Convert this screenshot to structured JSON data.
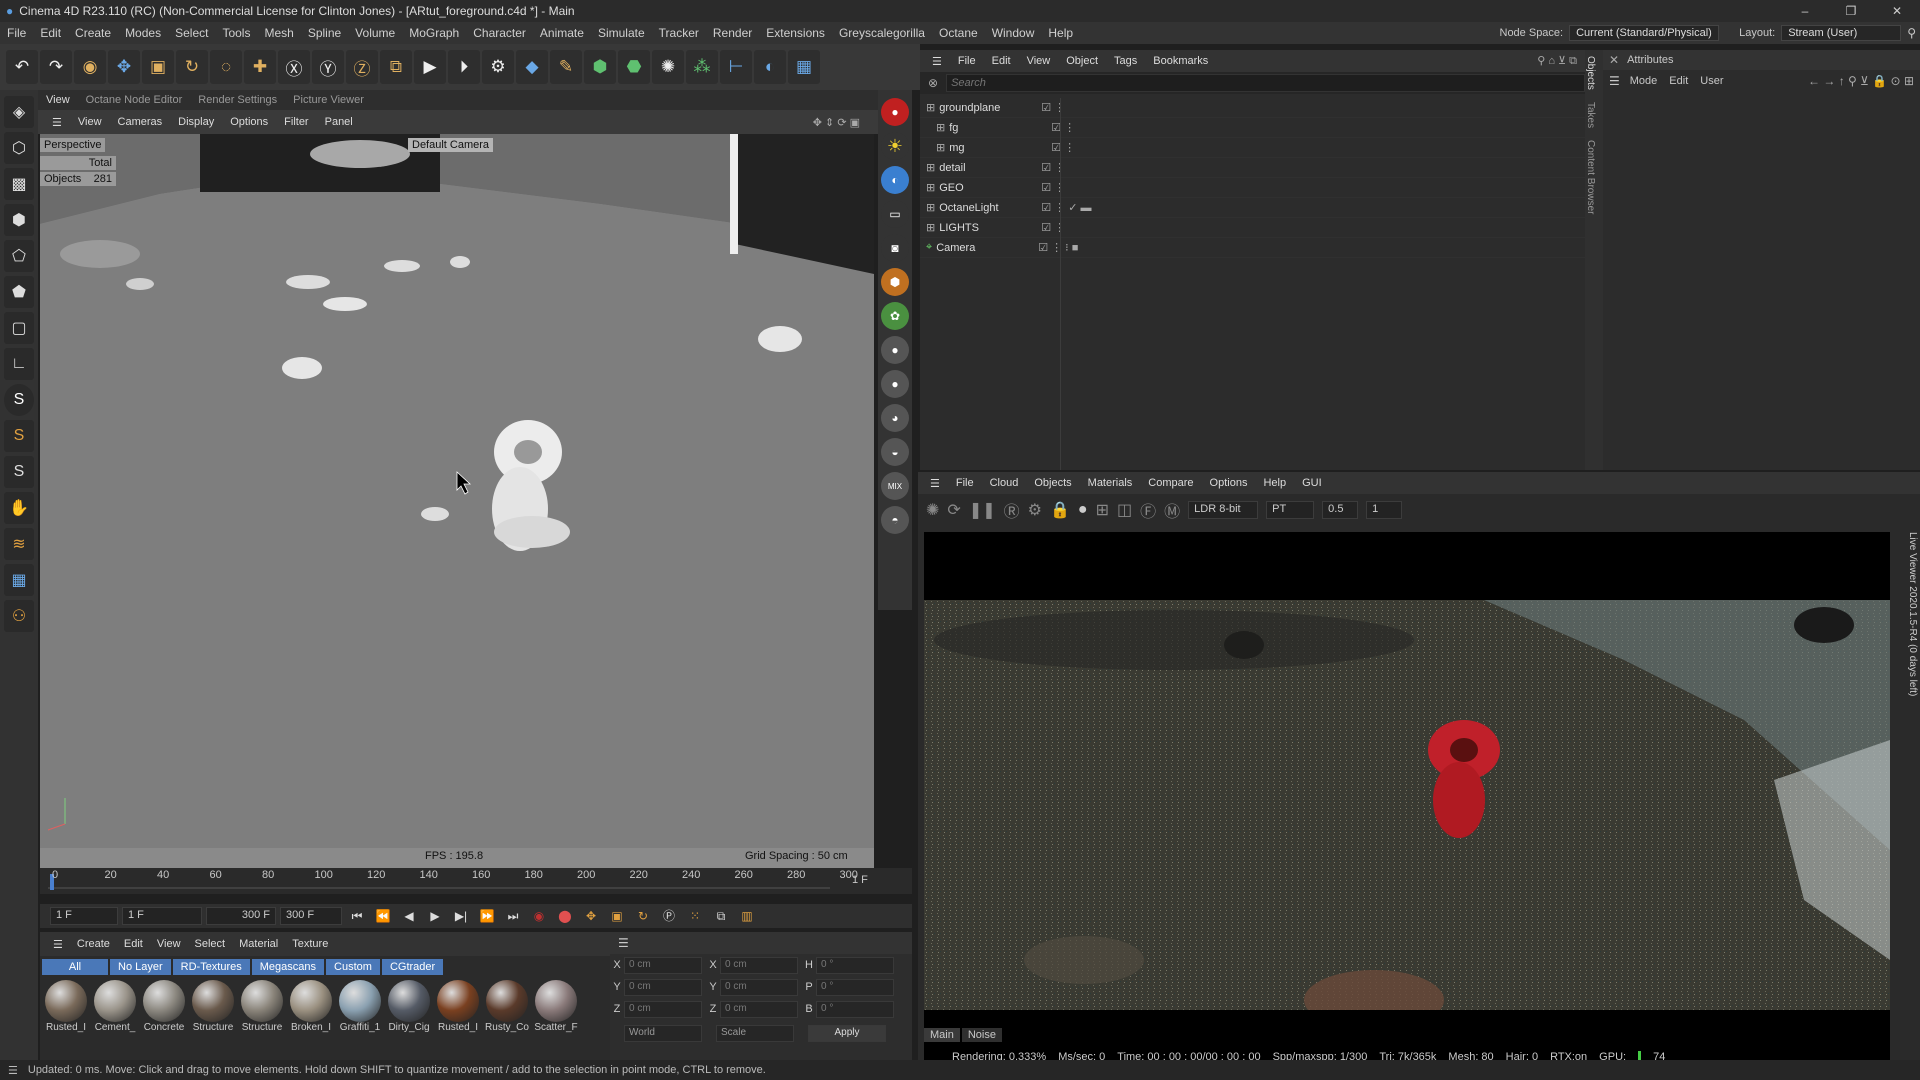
{
  "window": {
    "title": "Cinema 4D R23.110 (RC) (Non-Commercial License for Clinton Jones) - [ARtut_foreground.c4d *] - Main"
  },
  "menubar": {
    "items": [
      "File",
      "Edit",
      "Create",
      "Modes",
      "Select",
      "Tools",
      "Mesh",
      "Spline",
      "Volume",
      "MoGraph",
      "Character",
      "Animate",
      "Simulate",
      "Tracker",
      "Render",
      "Extensions",
      "Greyscalegorilla",
      "Octane",
      "Window",
      "Help"
    ],
    "node_space_label": "Node Space:",
    "node_space_value": "Current (Standard/Physical)",
    "layout_label": "Layout:",
    "layout_value": "Stream (User)"
  },
  "viewport": {
    "tabs": [
      "View",
      "Octane Node Editor",
      "Render Settings",
      "Picture Viewer"
    ],
    "menu": [
      "View",
      "Cameras",
      "Display",
      "Options",
      "Filter",
      "Panel"
    ],
    "projection": "Perspective",
    "camera": "Default Camera",
    "total_label": "Total",
    "objects_label": "Objects",
    "objects_count": "281",
    "fps": "FPS : 195.8",
    "grid_spacing": "Grid Spacing : 50 cm"
  },
  "timeline": {
    "ticks": [
      "0",
      "20",
      "40",
      "60",
      "80",
      "100",
      "120",
      "140",
      "160",
      "180",
      "200",
      "220",
      "240",
      "260",
      "280",
      "300"
    ],
    "current_frame": "1 F"
  },
  "transport": {
    "start": "1 F",
    "current": "1 F",
    "end": "300 F",
    "end2": "300 F"
  },
  "materials": {
    "menu": [
      "Create",
      "Edit",
      "View",
      "Select",
      "Material",
      "Texture"
    ],
    "filters": [
      "All",
      "No Layer",
      "RD-Textures",
      "Megascans",
      "Custom",
      "CGtrader"
    ],
    "items": [
      {
        "name": "Rusted_I",
        "color": "#7a6a5a"
      },
      {
        "name": "Cement_",
        "color": "#9a948a"
      },
      {
        "name": "Concrete",
        "color": "#8c8880"
      },
      {
        "name": "Structure",
        "color": "#6a5a4c"
      },
      {
        "name": "Structure",
        "color": "#8a847a"
      },
      {
        "name": "Broken_I",
        "color": "#9a9080"
      },
      {
        "name": "Graffiti_1",
        "color": "#8aa0b0"
      },
      {
        "name": "Dirty_Cig",
        "color": "#555b66"
      },
      {
        "name": "Rusted_I",
        "color": "#7a4020"
      },
      {
        "name": "Rusty_Co",
        "color": "#5a3a2a"
      },
      {
        "name": "Scatter_F",
        "color": "#8a7a7a"
      }
    ]
  },
  "coords": {
    "x": "0 cm",
    "y": "0 cm",
    "z": "0 cm",
    "sx": "0 cm",
    "sy": "0 cm",
    "sz": "0 cm",
    "h": "0 °",
    "p": "0 °",
    "b": "0 °",
    "world": "World",
    "scale": "Scale",
    "apply": "Apply"
  },
  "objects": {
    "menu": [
      "File",
      "Edit",
      "View",
      "Object",
      "Tags",
      "Bookmarks"
    ],
    "search_placeholder": "Search",
    "rows": [
      {
        "name": "groundplane"
      },
      {
        "name": "fg"
      },
      {
        "name": "mg"
      },
      {
        "name": "detail"
      },
      {
        "name": "GEO"
      },
      {
        "name": "OctaneLight"
      },
      {
        "name": "LIGHTS"
      },
      {
        "name": "Camera"
      }
    ]
  },
  "side_tabs": [
    "Objects",
    "Takes",
    "Content Browser"
  ],
  "attributes": {
    "title": "Attributes",
    "menu": [
      "Mode",
      "Edit",
      "User"
    ]
  },
  "octane": {
    "menu": [
      "File",
      "Cloud",
      "Objects",
      "Materials",
      "Compare",
      "Options",
      "Help",
      "GUI"
    ],
    "ldr": "LDR 8-bit",
    "mode": "PT",
    "value1": "0.5",
    "value2": "1",
    "tabs": [
      "Main",
      "Noise"
    ],
    "side_label": "Live Viewer 2020.1.5-R4 (0 days left)",
    "stats": {
      "rendering": "Rendering: 0.333%",
      "ms": "Ms/sec: 0",
      "time": "Time: 00 : 00 : 00/00 : 00 : 00",
      "spp": "Spp/maxspp: 1/300",
      "tri": "Tri: 7k/365k",
      "mesh": "Mesh: 80",
      "hair": "Hair: 0",
      "rtx": "RTX:on",
      "gpu": "GPU:",
      "gpu_val": "74"
    }
  },
  "status": {
    "text": "Updated: 0 ms.   Move: Click and drag to move elements. Hold down SHIFT to quantize movement / add to the selection in point mode, CTRL to remove."
  }
}
